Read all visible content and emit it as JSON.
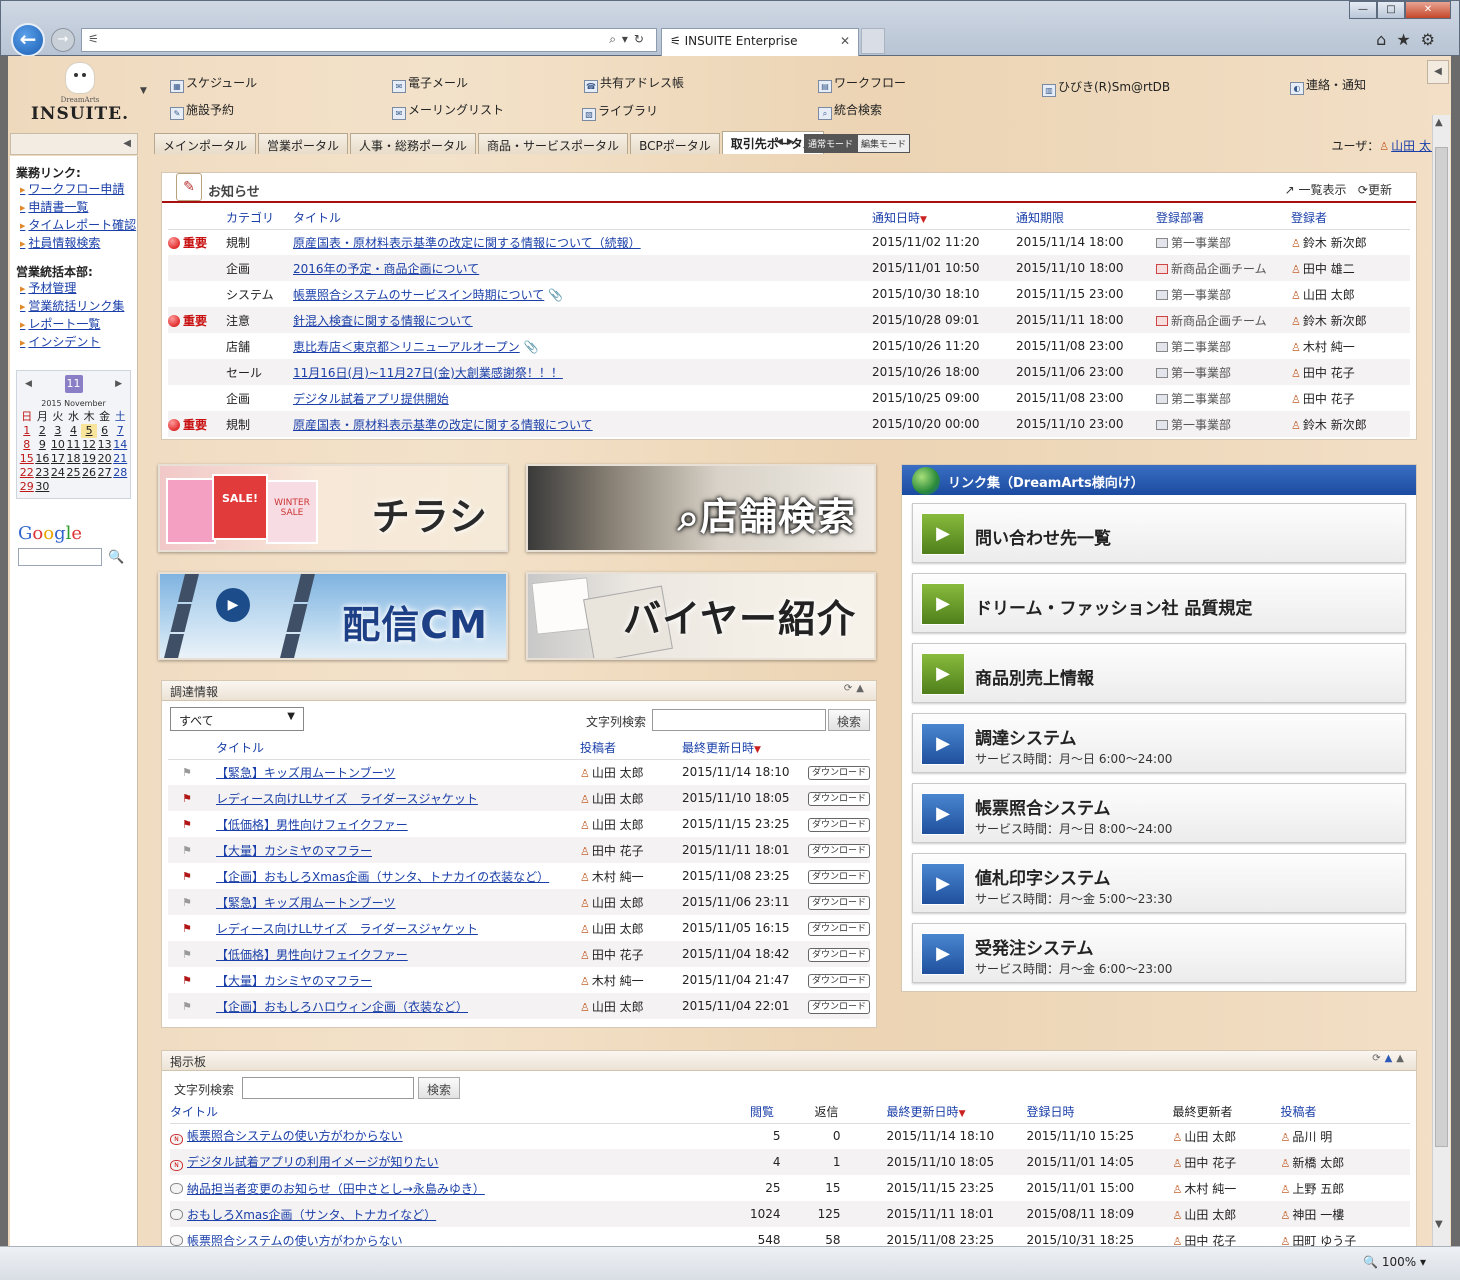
{
  "browser": {
    "tab_title": "INSUITE Enterprise",
    "zoom": "100%"
  },
  "header": {
    "logo_small": "DreamArts",
    "logo": "INSUITE.",
    "menu": [
      {
        "label": "スケジュール",
        "icon": "calendar-icon"
      },
      {
        "label": "電子メール",
        "icon": "mail-icon"
      },
      {
        "label": "共有アドレス帳",
        "icon": "addressbook-icon"
      },
      {
        "label": "ワークフロー",
        "icon": "workflow-icon"
      },
      {
        "label": "ひびき(R)Sm@rtDB",
        "icon": "database-icon"
      },
      {
        "label": "連絡・通知",
        "icon": "notice-icon"
      },
      {
        "label": "施設予約",
        "icon": "pencil-icon"
      },
      {
        "label": "メーリングリスト",
        "icon": "mailinglist-icon"
      },
      {
        "label": "ライブラリ",
        "icon": "library-icon"
      },
      {
        "label": "統合検索",
        "icon": "search-icon"
      }
    ]
  },
  "portal_tabs": [
    "メインポータル",
    "営業ポータル",
    "人事・総務ポータル",
    "商品・サービスポータル",
    "BCPポータル",
    "取引先ポータル"
  ],
  "active_tab": "取引先ポータル",
  "modes": [
    "通常モード",
    "編集モード"
  ],
  "user": {
    "label": "ユーザ：",
    "name": "山田 太郎"
  },
  "sidebar": {
    "group1_title": "業務リンク:",
    "group1": [
      "ワークフロー申請",
      "申請書一覧",
      "タイムレポート確認",
      "社員情報検索"
    ],
    "group2_title": "営業統括本部:",
    "group2": [
      "予材管理",
      "営業統括リンク集",
      "レポート一覧",
      "インシデント"
    ],
    "calendar": {
      "month_badge": "11",
      "caption": "2015 November",
      "weekdays": [
        "日",
        "月",
        "火",
        "水",
        "木",
        "金",
        "土"
      ],
      "today": "5"
    },
    "google": "Google"
  },
  "notice": {
    "title": "お知らせ",
    "list_label": "一覧表示",
    "refresh_label": "更新",
    "columns": [
      "カテゴリ",
      "タイトル",
      "通知日時",
      "通知期限",
      "登録部署",
      "登録者"
    ],
    "rows": [
      {
        "badge": "重要",
        "cat": "規制",
        "title": "原産国表・原材料表示基準の改定に関する情報について（続報）",
        "date": "2015/11/02 11:20",
        "limit": "2015/11/14 18:00",
        "dept": "第一事業部",
        "user": "鈴木 新次郎",
        "clip": ""
      },
      {
        "badge": "",
        "cat": "企画",
        "title": "2016年の予定・商品企画について",
        "date": "2015/11/01 10:50",
        "limit": "2015/11/10 18:00",
        "dept": "新商品企画チーム",
        "user": "田中 雄二",
        "clip": ""
      },
      {
        "badge": "",
        "cat": "システム",
        "title": "帳票照合システムのサービスイン時期について",
        "date": "2015/10/30 18:10",
        "limit": "2015/11/15 23:00",
        "dept": "第一事業部",
        "user": "山田 太郎",
        "clip": "📎"
      },
      {
        "badge": "重要",
        "cat": "注意",
        "title": "針混入検査に関する情報について",
        "date": "2015/10/28 09:01",
        "limit": "2015/11/11 18:00",
        "dept": "新商品企画チーム",
        "user": "鈴木 新次郎",
        "clip": ""
      },
      {
        "badge": "",
        "cat": "店舗",
        "title": "恵比寿店＜東京都＞リニューアルオープン",
        "date": "2015/10/26 11:20",
        "limit": "2015/11/08 23:00",
        "dept": "第二事業部",
        "user": "木村 純一",
        "clip": "📎"
      },
      {
        "badge": "",
        "cat": "セール",
        "title": "11月16日(月)~11月27日(金)大創業感謝祭！！！",
        "date": "2015/10/26 18:00",
        "limit": "2015/11/06 23:00",
        "dept": "第一事業部",
        "user": "田中 花子",
        "clip": ""
      },
      {
        "badge": "",
        "cat": "企画",
        "title": "デジタル試着アプリ提供開始",
        "date": "2015/10/25 09:00",
        "limit": "2015/11/08 23:00",
        "dept": "第二事業部",
        "user": "田中 花子",
        "clip": ""
      },
      {
        "badge": "重要",
        "cat": "規制",
        "title": "原産国表・原材料表示基準の改定に関する情報について",
        "date": "2015/10/20 00:00",
        "limit": "2015/11/10 23:00",
        "dept": "第一事業部",
        "user": "鈴木 新次郎",
        "clip": ""
      }
    ]
  },
  "banners": {
    "chirashi": "チラシ",
    "store": "店舗検索",
    "cm": "配信CM",
    "buyer": "バイヤー紹介",
    "flyer_sale": "SALE!",
    "flyer_winter": "WINTER SALE"
  },
  "links": {
    "title": "リンク集（DreamArts様向け）",
    "items": [
      {
        "label": "問い合わせ先一覧",
        "sub": "",
        "color": "green"
      },
      {
        "label": "ドリーム・ファッション社 品質規定",
        "sub": "",
        "color": "green"
      },
      {
        "label": "商品別売上情報",
        "sub": "",
        "color": "green"
      },
      {
        "label": "調達システム",
        "sub": "サービス時間：月〜日 6:00〜24:00",
        "color": "blue"
      },
      {
        "label": "帳票照合システム",
        "sub": "サービス時間：月〜日 8:00〜24:00",
        "color": "blue"
      },
      {
        "label": "値札印字システム",
        "sub": "サービス時間：月〜金 5:00〜23:30",
        "color": "blue"
      },
      {
        "label": "受発注システム",
        "sub": "サービス時間：月〜金 6:00〜23:00",
        "color": "blue"
      }
    ]
  },
  "procurement": {
    "title": "調達情報",
    "select_value": "すべて",
    "search_label": "文字列検索",
    "search_button": "検索",
    "columns": [
      "タイトル",
      "投稿者",
      "最終更新日時"
    ],
    "download": "ダウンロード",
    "rows": [
      {
        "flag": "gray",
        "title": "【緊急】キッズ用ムートンブーツ",
        "user": "山田 太郎",
        "date": "2015/11/14 18:10"
      },
      {
        "flag": "red",
        "title": "レディース向けLLサイズ　ライダースジャケット",
        "user": "山田 太郎",
        "date": "2015/11/10 18:05"
      },
      {
        "flag": "red",
        "title": "【低価格】男性向けフェイクファー",
        "user": "山田 太郎",
        "date": "2015/11/15 23:25"
      },
      {
        "flag": "gray",
        "title": "【大量】カシミヤのマフラー",
        "user": "田中 花子",
        "date": "2015/11/11 18:01"
      },
      {
        "flag": "red",
        "title": "【企画】おもしろXmas企画（サンタ、トナカイの衣装など）",
        "user": "木村 純一",
        "date": "2015/11/08 23:25"
      },
      {
        "flag": "gray",
        "title": "【緊急】キッズ用ムートンブーツ",
        "user": "山田 太郎",
        "date": "2015/11/06 23:11"
      },
      {
        "flag": "red",
        "title": "レディース向けLLサイズ　ライダースジャケット",
        "user": "山田 太郎",
        "date": "2015/11/05 16:15"
      },
      {
        "flag": "gray",
        "title": "【低価格】男性向けフェイクファー",
        "user": "田中 花子",
        "date": "2015/11/04 18:42"
      },
      {
        "flag": "red",
        "title": "【大量】カシミヤのマフラー",
        "user": "木村 純一",
        "date": "2015/11/04 21:47"
      },
      {
        "flag": "gray",
        "title": "【企画】おもしろハロウィン企画（衣装など）",
        "user": "山田 太郎",
        "date": "2015/11/04 22:01"
      }
    ]
  },
  "board": {
    "title": "掲示板",
    "search_label": "文字列検索",
    "search_button": "検索",
    "columns": [
      "タイトル",
      "閲覧",
      "返信",
      "最終更新日時",
      "登録日時",
      "最終更新者",
      "投稿者"
    ],
    "rows": [
      {
        "icon": "new",
        "title": "帳票照合システムの使い方がわからない",
        "views": "5",
        "replies": "0",
        "updated": "2015/11/14 18:10",
        "created": "2015/11/10 15:25",
        "updater": "山田 太郎",
        "poster": "品川 明"
      },
      {
        "icon": "new",
        "title": "デジタル試着アプリの利用イメージが知りたい",
        "views": "4",
        "replies": "1",
        "updated": "2015/11/10 18:05",
        "created": "2015/11/01 14:05",
        "updater": "田中 花子",
        "poster": "新橋 太郎"
      },
      {
        "icon": "bubble",
        "title": "納品担当者変更のお知らせ（田中さとし→永島みゆき）",
        "views": "25",
        "replies": "15",
        "updated": "2015/11/15 23:25",
        "created": "2015/11/01 15:00",
        "updater": "木村 純一",
        "poster": "上野 五郎"
      },
      {
        "icon": "bubble",
        "title": "おもしろXmas企画（サンタ、トナカイなど）",
        "views": "1024",
        "replies": "125",
        "updated": "2015/11/11 18:01",
        "created": "2015/08/11 18:09",
        "updater": "山田 太郎",
        "poster": "神田 一樓"
      },
      {
        "icon": "bubble",
        "title": "帳票照合システムの使い方がわからない",
        "views": "548",
        "replies": "58",
        "updated": "2015/11/08 23:25",
        "created": "2015/10/31 18:25",
        "updater": "田中 花子",
        "poster": "田町 ゆう子"
      }
    ]
  }
}
